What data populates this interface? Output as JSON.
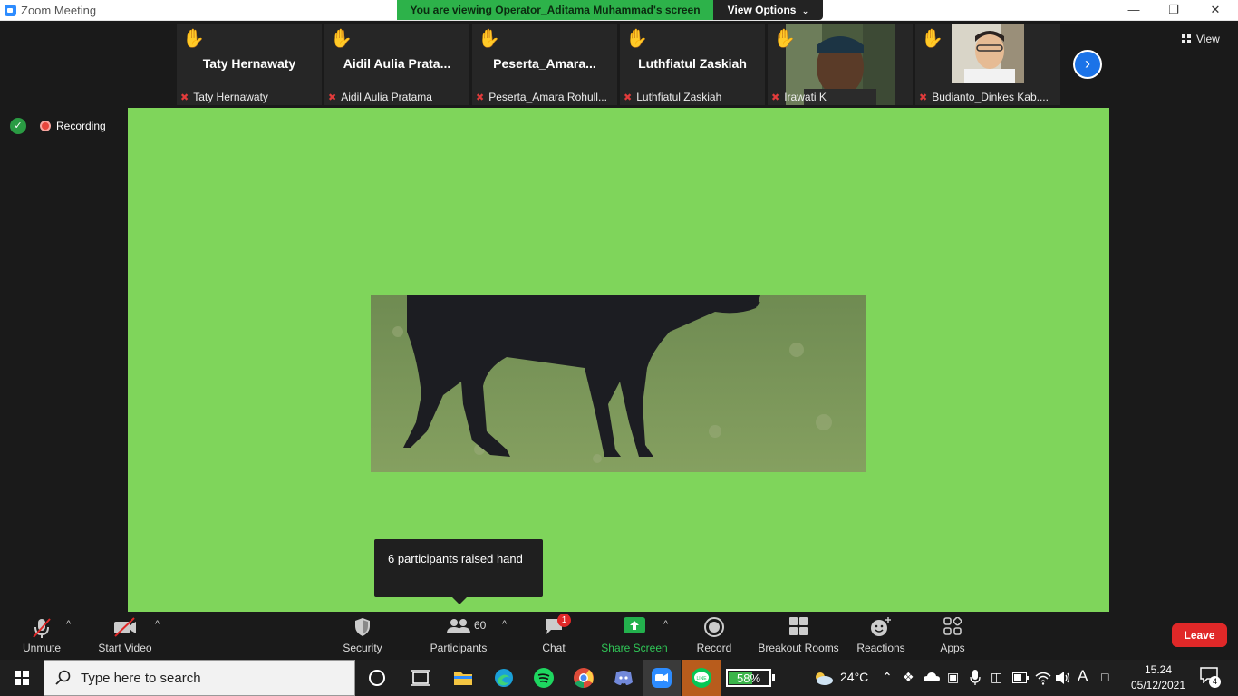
{
  "window": {
    "title": "Zoom Meeting",
    "banner": "You are viewing Operator_Aditama Muhammad's screen",
    "view_options": "View Options",
    "controls": [
      "—",
      "❐",
      "✕"
    ]
  },
  "gallery": {
    "tiles": [
      {
        "display_name": "Taty Hernawaty",
        "label": "Taty Hernawaty",
        "raised_hand": true,
        "has_video": false
      },
      {
        "display_name": "Aidil  Aulia  Prata...",
        "label": "Aidil Aulia Pratama",
        "raised_hand": true,
        "has_video": false
      },
      {
        "display_name": "Peserta_Amara...",
        "label": "Peserta_Amara Rohull...",
        "raised_hand": true,
        "has_video": false
      },
      {
        "display_name": "Luthfiatul Zaskiah",
        "label": "Luthfiatul Zaskiah",
        "raised_hand": true,
        "has_video": false
      },
      {
        "display_name": "",
        "label": "Irawati K",
        "raised_hand": true,
        "has_video": true
      },
      {
        "display_name": "",
        "label": "Budianto_Dinkes Kab....",
        "raised_hand": true,
        "has_video": true
      }
    ],
    "hand_glyph": "✋",
    "next_glyph": "›",
    "view_label": "View"
  },
  "status": {
    "recording": "Recording",
    "security_glyph": "✓"
  },
  "shared_screen": {
    "background": "#7fd55b"
  },
  "tooltip": {
    "text": "6 participants raised hand"
  },
  "toolbar": {
    "unmute": "Unmute",
    "start_video": "Start Video",
    "security": "Security",
    "participants": "Participants",
    "participants_count": "60",
    "chat": "Chat",
    "chat_badge": "1",
    "share_screen": "Share Screen",
    "record": "Record",
    "breakout_rooms": "Breakout Rooms",
    "reactions": "Reactions",
    "apps": "Apps",
    "leave": "Leave",
    "caret": "^"
  },
  "taskbar": {
    "search_placeholder": "Type here to search",
    "battery_percent": 58,
    "battery_label": "58%",
    "weather": "24°C",
    "time": "15.24",
    "date": "05/12/2021",
    "notification_count": "4",
    "language": "A"
  }
}
